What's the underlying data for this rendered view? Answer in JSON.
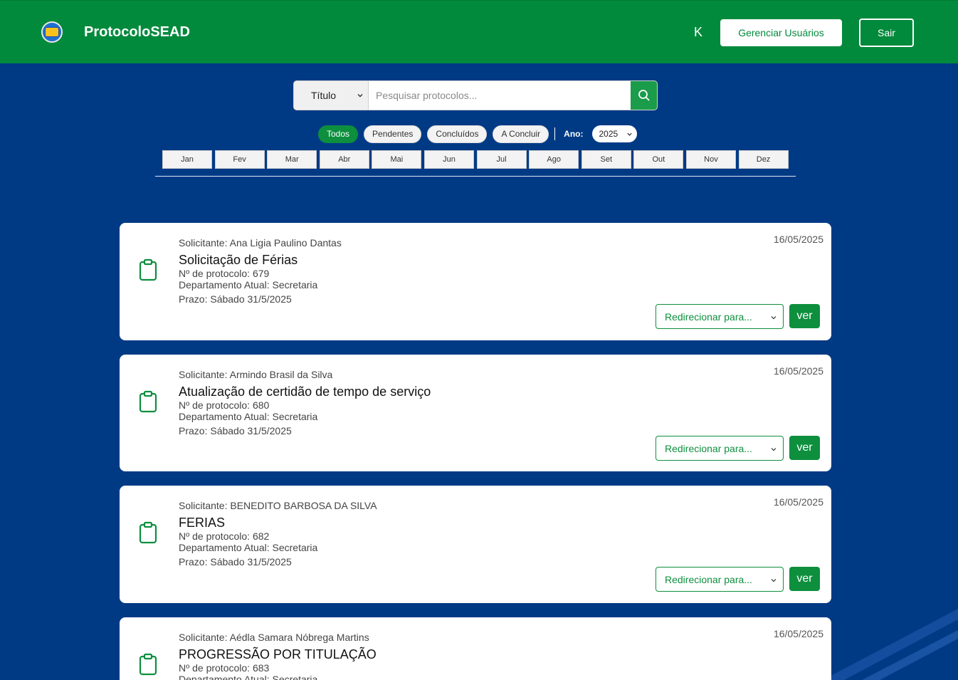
{
  "header": {
    "brand": "ProtocoloSEAD",
    "user_initial": "K",
    "manage_label": "Gerenciar Usuários",
    "exit_label": "Sair"
  },
  "search": {
    "field_value": "Título",
    "placeholder": "Pesquisar protocolos..."
  },
  "filters": {
    "chips": [
      {
        "label": "Todos",
        "active": true
      },
      {
        "label": "Pendentes",
        "active": false
      },
      {
        "label": "Concluídos",
        "active": false
      },
      {
        "label": "A Concluir",
        "active": false
      }
    ],
    "year_label": "Ano:",
    "year_value": "2025"
  },
  "months": [
    "Jan",
    "Fev",
    "Mar",
    "Abr",
    "Mai",
    "Jun",
    "Jul",
    "Ago",
    "Set",
    "Out",
    "Nov",
    "Dez"
  ],
  "cards": [
    {
      "solicitante": "Solicitante: Ana Ligia Paulino Dantas",
      "title": "Solicitação de Férias",
      "protocolo": "Nº de protocolo: 679",
      "departamento": "Departamento Atual: Secretaria",
      "prazo": "Prazo: Sábado 31/5/2025",
      "date": "16/05/2025",
      "redirect_label": "Redirecionar para...",
      "ver_label": "ver"
    },
    {
      "solicitante": "Solicitante: Armindo Brasil da Silva",
      "title": "Atualização de certidão de tempo de serviço",
      "protocolo": "Nº de protocolo: 680",
      "departamento": "Departamento Atual: Secretaria",
      "prazo": "Prazo: Sábado 31/5/2025",
      "date": "16/05/2025",
      "redirect_label": "Redirecionar para...",
      "ver_label": "ver"
    },
    {
      "solicitante": "Solicitante: BENEDITO BARBOSA DA SILVA",
      "title": "FERIAS",
      "protocolo": "Nº de protocolo: 682",
      "departamento": "Departamento Atual: Secretaria",
      "prazo": "Prazo: Sábado 31/5/2025",
      "date": "16/05/2025",
      "redirect_label": "Redirecionar para...",
      "ver_label": "ver"
    },
    {
      "solicitante": "Solicitante: Aédla Samara Nóbrega Martins",
      "title": "PROGRESSÃO POR TITULAÇÃO",
      "protocolo": "Nº de protocolo: 683",
      "departamento": "Departamento Atual: Secretaria",
      "prazo": "",
      "date": "16/05/2025",
      "redirect_label": "",
      "ver_label": ""
    }
  ],
  "colors": {
    "header_green": "#028a3c",
    "background_blue": "#003a85",
    "accent_green": "#0d8f3e"
  },
  "icons": {
    "logo": "sead-logo",
    "search": "search-icon",
    "card": "clipboard-icon",
    "select": "chevron-down-icon"
  }
}
